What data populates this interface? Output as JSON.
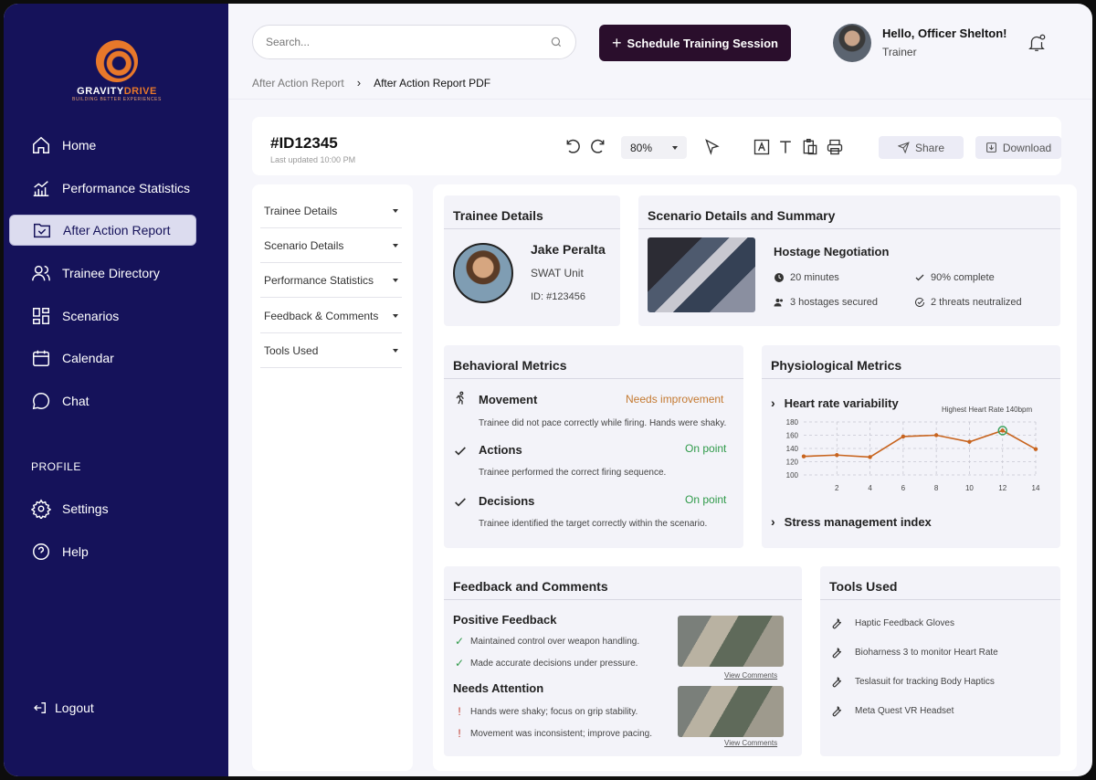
{
  "brand": {
    "name_part1": "GRAVITY",
    "name_part2": "DRIVE",
    "tagline": "BUILDING BETTER EXPERIENCES"
  },
  "sidebar": {
    "items": [
      {
        "label": "Home",
        "icon": "home-icon"
      },
      {
        "label": "Performance Statistics",
        "icon": "bar-chart-icon"
      },
      {
        "label": "After Action Report",
        "icon": "folder-check-icon",
        "active": true
      },
      {
        "label": "Trainee Directory",
        "icon": "users-icon"
      },
      {
        "label": "Scenarios",
        "icon": "layout-grid-icon"
      },
      {
        "label": "Calendar",
        "icon": "calendar-icon"
      },
      {
        "label": "Chat",
        "icon": "chat-bubble-icon"
      }
    ],
    "profile_label": "PROFILE",
    "profile_items": [
      {
        "label": "Settings",
        "icon": "gear-icon"
      },
      {
        "label": "Help",
        "icon": "help-icon"
      }
    ],
    "logout_label": "Logout"
  },
  "topbar": {
    "search_placeholder": "Search...",
    "schedule_label": "Schedule Training Session",
    "greeting": "Hello, Officer Shelton!",
    "role": "Trainer"
  },
  "breadcrumb": {
    "parent": "After Action Report",
    "current": "After Action Report PDF"
  },
  "toolbar": {
    "doc_id": "#ID12345",
    "updated": "Last updated 10:00 PM",
    "zoom": "80%",
    "share_label": "Share",
    "download_label": "Download"
  },
  "outline": [
    "Trainee Details",
    "Scenario Details",
    "Performance Statistics",
    "Feedback & Comments",
    "Tools Used"
  ],
  "trainee": {
    "title": "Trainee Details",
    "name": "Jake Peralta",
    "unit": "SWAT Unit",
    "id": "ID: #123456"
  },
  "scenario": {
    "title": "Scenario Details and Summary",
    "name": "Hostage Negotiation",
    "duration": "20 minutes",
    "completion": "90% complete",
    "hostages": "3 hostages secured",
    "threats": "2 threats neutralized"
  },
  "behavioral": {
    "title": "Behavioral Metrics",
    "rows": [
      {
        "name": "Movement",
        "status": "Needs improvement",
        "status_color": "#c47a32",
        "desc": "Trainee did not pace correctly while firing. Hands were shaky."
      },
      {
        "name": "Actions",
        "status": "On point",
        "status_color": "#2f9a4a",
        "desc": "Trainee performed the correct firing sequence."
      },
      {
        "name": "Decisions",
        "status": "On point",
        "status_color": "#2f9a4a",
        "desc": "Trainee identified the target correctly within the scenario."
      }
    ]
  },
  "physiological": {
    "title": "Physiological Metrics",
    "hrv_label": "Heart rate variability",
    "stress_label": "Stress management index",
    "annotation": "Highest Heart Rate 140bpm"
  },
  "chart_data": {
    "type": "line",
    "x": [
      0,
      2,
      4,
      6,
      8,
      10,
      12,
      14
    ],
    "series": [
      {
        "values": [
          128,
          130,
          127,
          158,
          160,
          150,
          167,
          139
        ]
      }
    ],
    "xticks": [
      2,
      4,
      6,
      8,
      10,
      12,
      14
    ],
    "yticks": [
      100,
      120,
      140,
      160,
      180
    ],
    "xlim": [
      0,
      14
    ],
    "ylim": [
      100,
      180
    ],
    "highlight_x": 12,
    "grid": true,
    "line_color": "#c8641e",
    "highlight_color": "#3aa05a"
  },
  "feedback": {
    "title": "Feedback and Comments",
    "positive_title": "Positive Feedback",
    "positive": [
      "Maintained control over weapon handling.",
      "Made accurate decisions under pressure."
    ],
    "attention_title": "Needs Attention",
    "attention": [
      "Hands were shaky; focus on grip stability.",
      "Movement was inconsistent; improve pacing."
    ],
    "view_comments": "View Comments"
  },
  "tools": {
    "title": "Tools Used",
    "items": [
      "Haptic Feedback Gloves",
      "Bioharness 3 to monitor Heart Rate",
      "Teslasuit for tracking Body Haptics",
      "Meta Quest VR Headset"
    ]
  },
  "colors": {
    "sidebar_bg": "#15125a",
    "accent_orange": "#e8782a",
    "button_dark": "#2a0e2c"
  }
}
